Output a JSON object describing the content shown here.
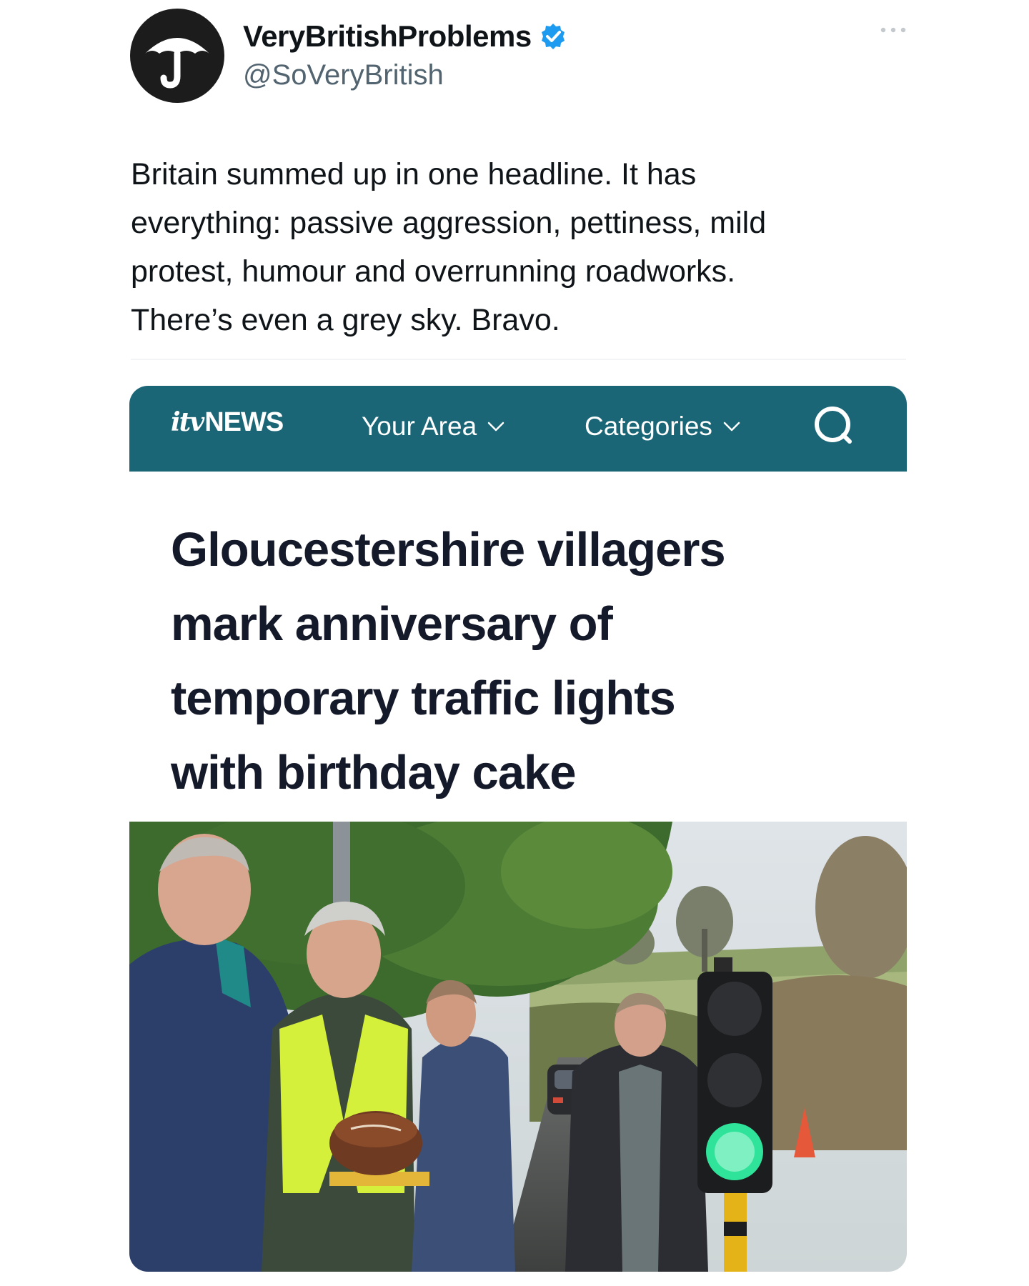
{
  "tweet": {
    "display_name": "VeryBritishProblems",
    "handle": "@SoVeryBritish",
    "verified": true,
    "text_lines": [
      "Britain summed up in one headline. It has",
      "everything: passive aggression, pettiness, mild",
      "protest, humour and overrunning roadworks.",
      "There’s even a grey sky. Bravo."
    ],
    "avatar_icon": "umbrella-icon",
    "more_icon": "more-options-icon"
  },
  "itv": {
    "logo_mark": "itv",
    "logo_text": "NEWS",
    "nav": {
      "your_area": "Your Area",
      "categories": "Categories"
    },
    "search_icon": "search-icon",
    "headline_lines": [
      "Gloucestershire villagers",
      "mark anniversary of",
      "temporary traffic lights",
      "with birthday cake"
    ],
    "photo_icon": "news-photo"
  },
  "colors": {
    "itv_teal": "#1a6676",
    "verified_blue": "#1d9bf0",
    "handle_grey": "#536471",
    "headline_navy": "#151a2b",
    "traffic_green": "#2fe39a"
  }
}
